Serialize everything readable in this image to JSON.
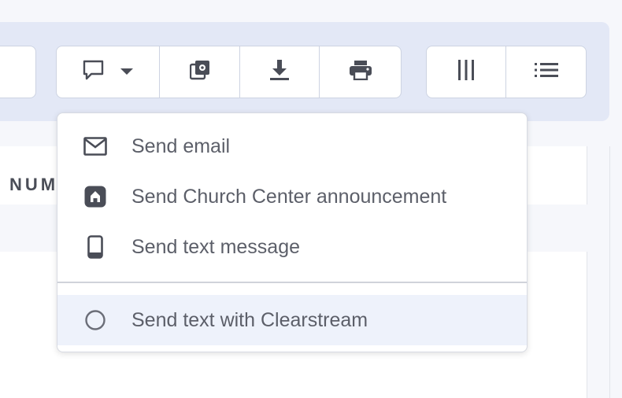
{
  "toolbar": {
    "buttons": [
      {
        "icon": "chat-bubble-icon",
        "dropdown": true
      },
      {
        "icon": "copy-settings-icon"
      },
      {
        "icon": "download-icon"
      },
      {
        "icon": "print-icon"
      },
      {
        "icon": "columns-icon"
      },
      {
        "icon": "list-icon"
      }
    ]
  },
  "table": {
    "column_header": "NUM"
  },
  "send_menu": {
    "items": [
      {
        "label": "Send email",
        "icon": "envelope-icon"
      },
      {
        "label": "Send Church Center announcement",
        "icon": "church-center-icon"
      },
      {
        "label": "Send text message",
        "icon": "phone-icon"
      },
      {
        "label": "Send text with Clearstream",
        "icon": "circle-icon",
        "highlighted": true
      }
    ]
  },
  "colors": {
    "toolbar_bg": "#e3e8f6",
    "icon": "#4a4d57",
    "menu_text": "#5c5f69",
    "highlight_bg": "#eef2fb"
  }
}
